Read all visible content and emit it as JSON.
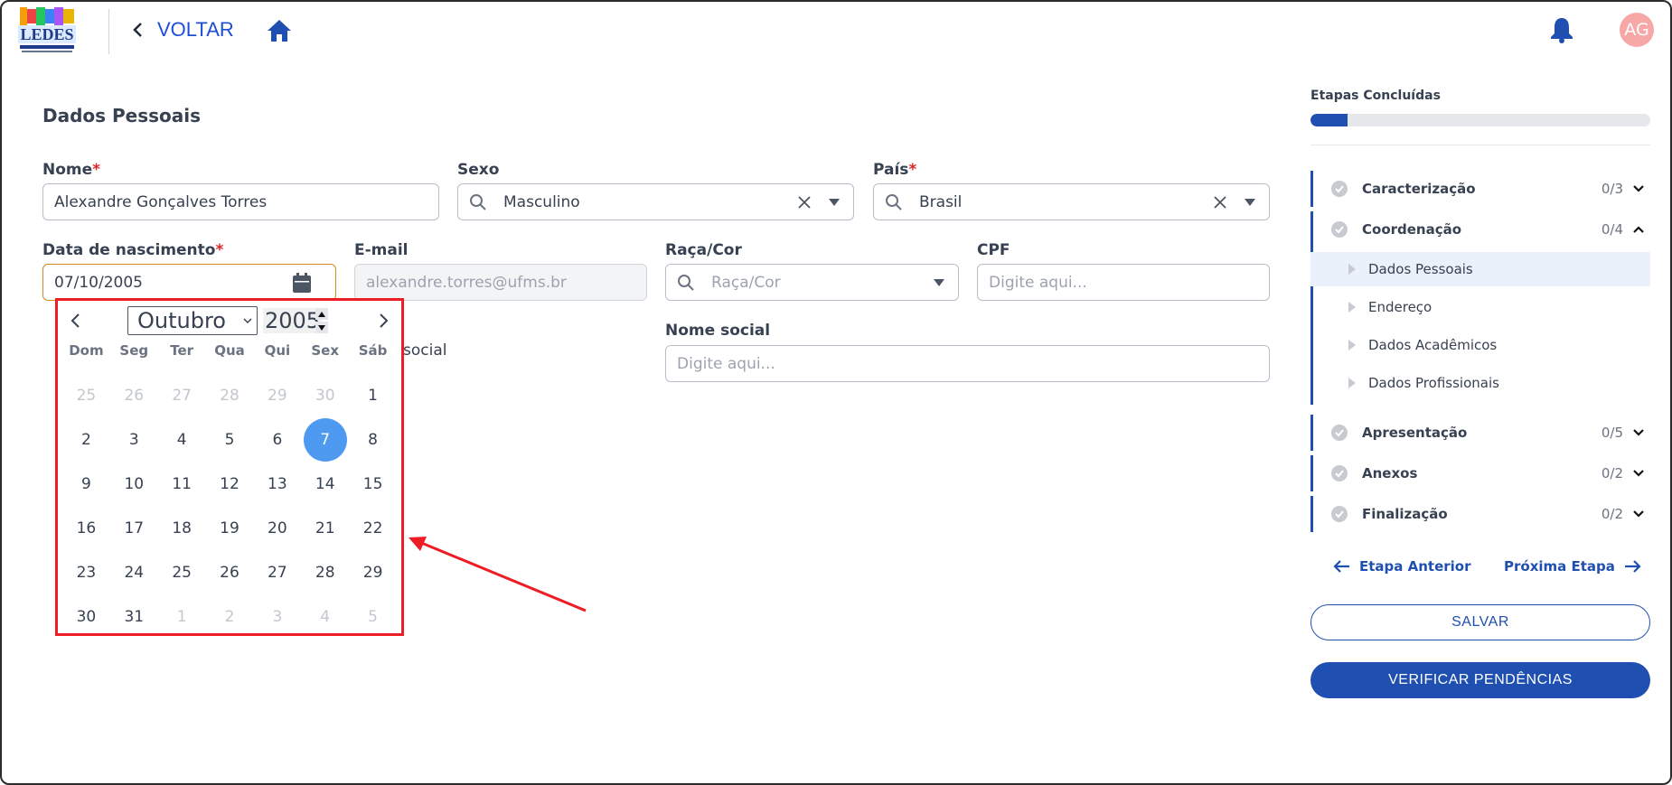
{
  "header": {
    "logo_text": "LEDES",
    "back_label": "VOLTAR",
    "avatar_initials": "AG"
  },
  "form": {
    "section_title": "Dados Pessoais",
    "nome": {
      "label": "Nome",
      "value": "Alexandre Gonçalves Torres"
    },
    "sexo": {
      "label": "Sexo",
      "value": "Masculino"
    },
    "pais": {
      "label": "País",
      "value": "Brasil"
    },
    "nascimento": {
      "label": "Data de nascimento",
      "value": "07/10/2005"
    },
    "email": {
      "label": "E-mail",
      "value": "alexandre.torres@ufms.br"
    },
    "raca": {
      "label": "Raça/Cor",
      "placeholder": "Raça/Cor"
    },
    "cpf": {
      "label": "CPF",
      "placeholder": "Digite aqui..."
    },
    "nome_social": {
      "label": "Nome social",
      "placeholder": "Digite aqui..."
    },
    "social_partial": "social",
    "required_mark": "*"
  },
  "calendar": {
    "month": "Outubro",
    "year": "2005",
    "weekdays": [
      "Dom",
      "Seg",
      "Ter",
      "Qua",
      "Qui",
      "Sex",
      "Sáb"
    ],
    "days": [
      {
        "d": "25",
        "out": true
      },
      {
        "d": "26",
        "out": true
      },
      {
        "d": "27",
        "out": true
      },
      {
        "d": "28",
        "out": true
      },
      {
        "d": "29",
        "out": true
      },
      {
        "d": "30",
        "out": true
      },
      {
        "d": "1"
      },
      {
        "d": "2"
      },
      {
        "d": "3"
      },
      {
        "d": "4"
      },
      {
        "d": "5"
      },
      {
        "d": "6"
      },
      {
        "d": "7",
        "selected": true
      },
      {
        "d": "8"
      },
      {
        "d": "9"
      },
      {
        "d": "10"
      },
      {
        "d": "11"
      },
      {
        "d": "12"
      },
      {
        "d": "13"
      },
      {
        "d": "14"
      },
      {
        "d": "15"
      },
      {
        "d": "16"
      },
      {
        "d": "17"
      },
      {
        "d": "18"
      },
      {
        "d": "19"
      },
      {
        "d": "20"
      },
      {
        "d": "21"
      },
      {
        "d": "22"
      },
      {
        "d": "23"
      },
      {
        "d": "24"
      },
      {
        "d": "25"
      },
      {
        "d": "26"
      },
      {
        "d": "27"
      },
      {
        "d": "28"
      },
      {
        "d": "29"
      },
      {
        "d": "30"
      },
      {
        "d": "31"
      },
      {
        "d": "1",
        "out": true
      },
      {
        "d": "2",
        "out": true
      },
      {
        "d": "3",
        "out": true
      },
      {
        "d": "4",
        "out": true
      },
      {
        "d": "5",
        "out": true
      }
    ]
  },
  "sidebar": {
    "title": "Etapas Concluídas",
    "progress_fraction": 0.11,
    "steps": [
      {
        "name": "Caracterização",
        "count": "0/3"
      },
      {
        "name": "Coordenação",
        "count": "0/4"
      },
      {
        "name": "Apresentação",
        "count": "0/5"
      },
      {
        "name": "Anexos",
        "count": "0/2"
      },
      {
        "name": "Finalização",
        "count": "0/2"
      }
    ],
    "substeps": [
      "Dados Pessoais",
      "Endereço",
      "Dados Acadêmicos",
      "Dados Profissionais"
    ],
    "prev_label": "Etapa Anterior",
    "next_label": "Próxima Etapa",
    "save_label": "SALVAR",
    "verify_label": "VERIFICAR PENDÊNCIAS"
  },
  "colors": {
    "primary": "#1f4fb0",
    "link": "#1d4ed8",
    "required": "#dc2626",
    "annotation": "#ee1c24",
    "selected_day": "#4e9af1",
    "avatar": "#f8a7a7"
  }
}
